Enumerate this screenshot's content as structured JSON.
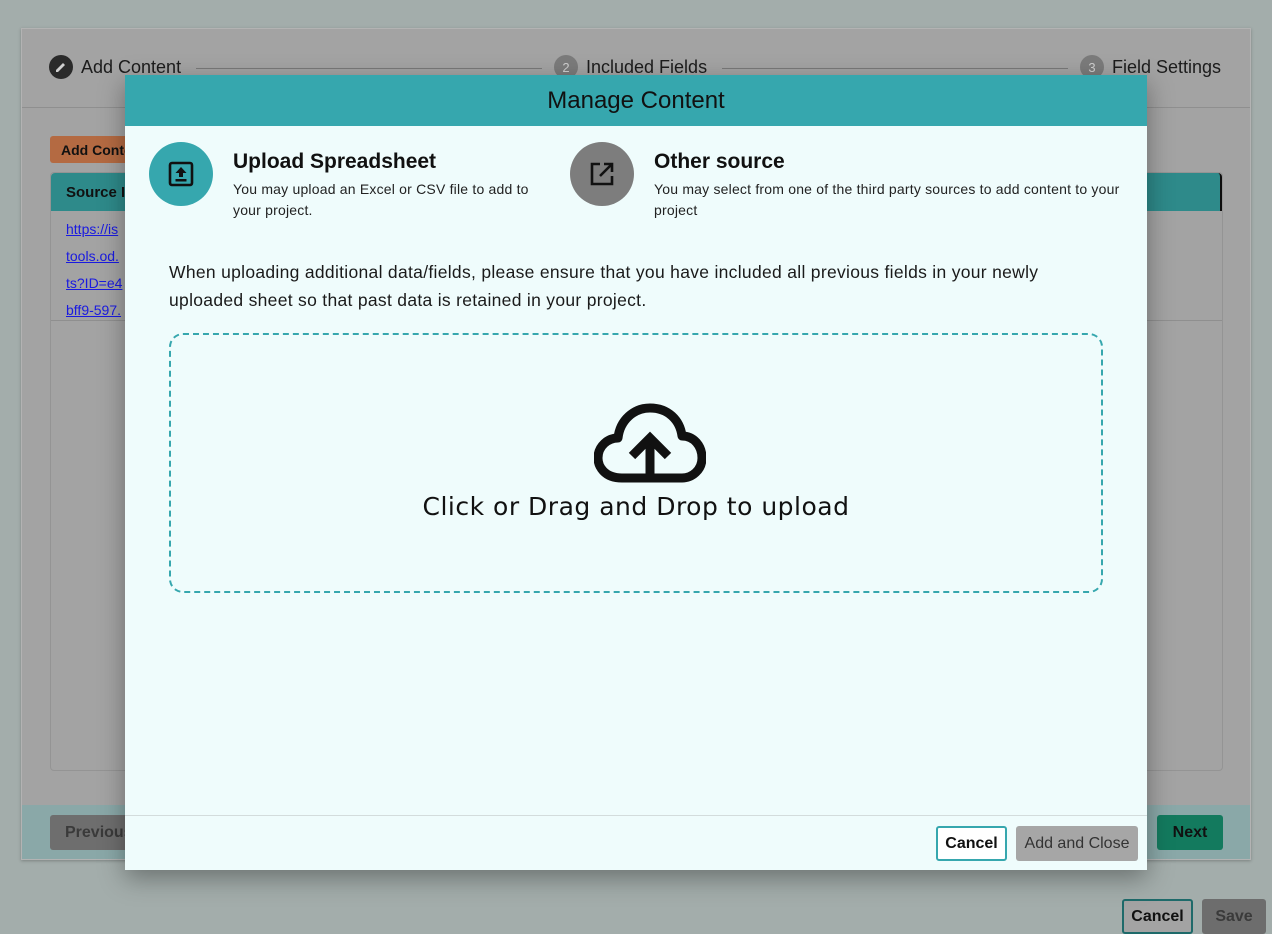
{
  "stepper": {
    "steps": [
      {
        "number": "",
        "label": "Add Content",
        "icon": "pencil-icon"
      },
      {
        "number": "2",
        "label": "Included Fields"
      },
      {
        "number": "3",
        "label": "Field Settings"
      }
    ]
  },
  "background": {
    "add_content_label": "Add Content",
    "table_header": "Source Info",
    "links": [
      "https://is",
      "tools.od.",
      "ts?ID=e4",
      "bff9-597."
    ],
    "previous_label": "Previous",
    "next_label": "Next",
    "cancel_label": "Cancel",
    "save_label": "Save"
  },
  "modal": {
    "title": "Manage Content",
    "options": [
      {
        "title": "Upload Spreadsheet",
        "description": "You may upload an Excel or CSV file to add to your project.",
        "icon": "upload-icon"
      },
      {
        "title": "Other source",
        "description": "You may select from one of the third party sources to add content to your project",
        "icon": "external-link-icon"
      }
    ],
    "notice": "When uploading additional data/fields, please ensure that you have included all previous fields in your newly uploaded sheet so that past data is retained in your project.",
    "dropzone_text": "Click or Drag and Drop to upload",
    "cancel_label": "Cancel",
    "add_close_label": "Add and Close"
  },
  "colors": {
    "accent": "#36a7ae",
    "next": "#137a5e",
    "add_content": "#b46a42"
  }
}
